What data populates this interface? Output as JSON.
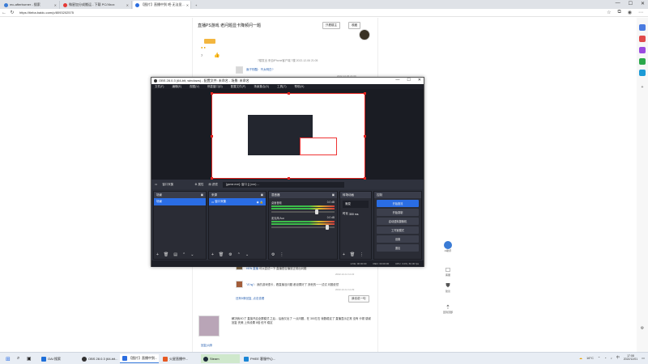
{
  "browser": {
    "tabs": [
      {
        "label": "mc-afterburner - 搜索",
        "color": "#3a7bd5",
        "active": false
      },
      {
        "label": "微星加分成搬运 - 下载 PC/Xbox",
        "color": "#e53935",
        "active": false
      },
      {
        "label": "【图片】直播中到 吧·无法显...",
        "color": "#2b6de0",
        "active": true
      }
    ],
    "url": "https://tieba.baidu.com/p/8093202575"
  },
  "webpage": {
    "post_title": "直播PS游戏 老问题显卡降频问一题",
    "reply_button": "只看楼主",
    "reply_all_button": "收藏",
    "user_level": "7",
    "post_meta": "7楼发出 来自iPhone客户端 7楼 2022-12-06 21:05",
    "reply_meta": "2022-12-06 21:09",
    "reply1": "面子别酷：不太明白?",
    "reply2_user": "HEN 直播",
    "reply2": "可以尝试一下 直播是否播放正常出问题",
    "reply2_meta": "2022-12-11 11:22",
    "reply3_user": "\"A\"ng\"",
    "reply3": "：我的游戏很卡，看直播没问题 都设置好了 其他的一一试试 问题依然",
    "reply3_meta": "2022-12-11 11:29",
    "more_replies": "还有5条回复, 点击查看",
    "reply_box_btn": "我也说一句",
    "floor_text": "解决我XD了 直接开启全屏模式 之后... 后面又出了 一点问题，在 300左右 帧数稳定了 直播显示正常 没有 卡顿 感谢回复 完美 上传设置 8倍 但不 稳定",
    "floor_link": "回复(4)条"
  },
  "obs": {
    "title": "OBS 28.0.3 (64-bit, windows) - 配置文件: 未命名 - 场景: 未命名",
    "menu": [
      "文件(F)",
      "编辑(E)",
      "视图(V)",
      "停靠窗口(D)",
      "配置文件(P)",
      "场景集合(S)",
      "工具(T)",
      "帮助(H)"
    ],
    "source_label": "窗口采集",
    "source_props": "属性",
    "source_filters": "滤镜",
    "window_select": "[game.exe]: 窗口 [] (xxx) ...",
    "docks": {
      "scenes": {
        "title": "场景",
        "items": [
          "场景"
        ]
      },
      "sources": {
        "title": "来源",
        "items": [
          "窗口采集"
        ]
      },
      "mixer": {
        "title": "混音器",
        "tracks": [
          {
            "name": "桌面音频",
            "db": "0.0 dB",
            "level": 0.72
          },
          {
            "name": "麦克风/Aux",
            "db": "0.0 dB",
            "level": 0.88
          }
        ]
      },
      "transitions": {
        "title": "转场动画",
        "type": "渐变",
        "duration_label": "时长",
        "duration": "300 ms"
      },
      "controls": {
        "title": "控制",
        "buttons": [
          "开始推流",
          "开始录制",
          "启动虚拟摄像机",
          "工作室模式",
          "设置",
          "退出"
        ]
      }
    },
    "status": [
      "LIVE: 00:00:00",
      "REC: 00:00:00",
      "CPU: 3.0%, 60.00 fps"
    ]
  },
  "taskbar": {
    "apps": [
      {
        "label": "OAI 搜索",
        "color": "#1e6fd9"
      },
      {
        "label": "OBS 28.0.3 (64-bit...",
        "color": "#303030"
      },
      {
        "label": "【图片】直播中到...",
        "color": "#2b6de0"
      },
      {
        "label": "火星直播中...",
        "color": "#e65a23"
      },
      {
        "label": "Steam",
        "color": "#1b2838"
      },
      {
        "label": "PHEE 客服中心...",
        "color": "#1a86d6"
      }
    ],
    "temperature": "16°C",
    "lang": "中",
    "time": "17:08",
    "date": "2022/12/01"
  },
  "sidebar_float": [
    "AI助手",
    "客服",
    "建议",
    "回到顶部"
  ]
}
